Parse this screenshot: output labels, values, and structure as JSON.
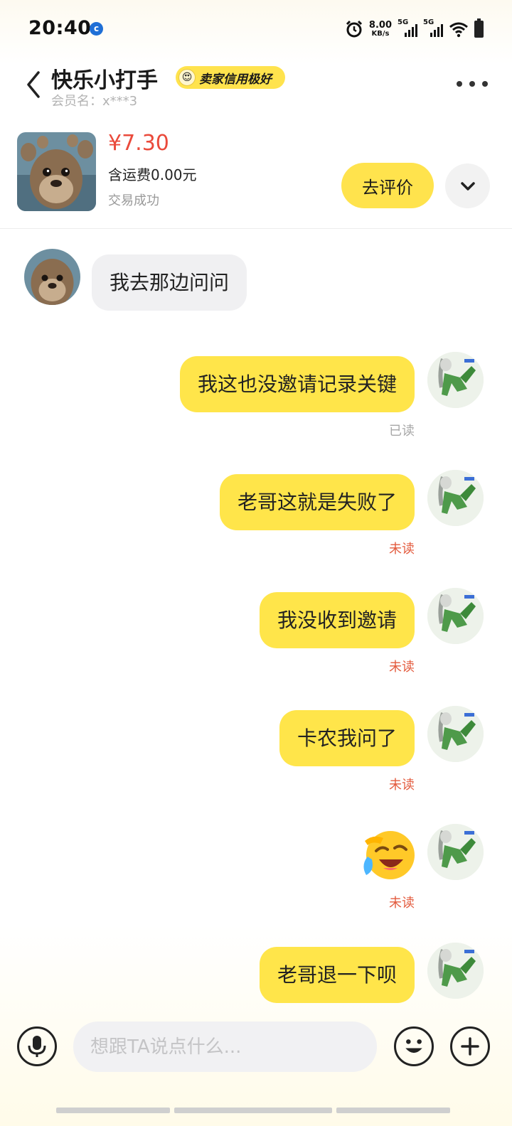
{
  "status_bar": {
    "time": "20:40",
    "net_speed_value": "8.00",
    "net_speed_unit": "KB/s",
    "sim1_label": "5G",
    "sim2_label": "5G"
  },
  "header": {
    "seller_name": "快乐小打手",
    "badge": "卖家信用极好",
    "member_label": "会员名：x***3"
  },
  "product": {
    "price": "¥7.30",
    "shipping": "含运费0.00元",
    "status": "交易成功",
    "review_button": "去评价"
  },
  "messages": [
    {
      "side": "in",
      "text": "我去那边问问"
    },
    {
      "side": "out",
      "text": "我这也没邀请记录关键",
      "receipt": "已读"
    },
    {
      "side": "out",
      "text": "老哥这就是失败了",
      "receipt": "未读"
    },
    {
      "side": "out",
      "text": "我没收到邀请",
      "receipt": "未读"
    },
    {
      "side": "out",
      "text": "卡农我问了",
      "receipt": "未读"
    },
    {
      "side": "out",
      "sticker": "crying-laughing-emoji",
      "receipt": "未读"
    },
    {
      "side": "out",
      "text": "老哥退一下呗"
    }
  ],
  "composer": {
    "placeholder": "想跟TA说点什么..."
  },
  "icons": [
    "back-arrow-icon",
    "more-dots-icon",
    "chevron-down-icon",
    "microphone-icon",
    "smiley-icon",
    "plus-icon",
    "alarm-icon",
    "wifi-icon",
    "battery-icon"
  ],
  "colors": {
    "accent_yellow": "#ffe34d",
    "price_red": "#ea4a3b",
    "unread_red": "#e35b3e"
  }
}
